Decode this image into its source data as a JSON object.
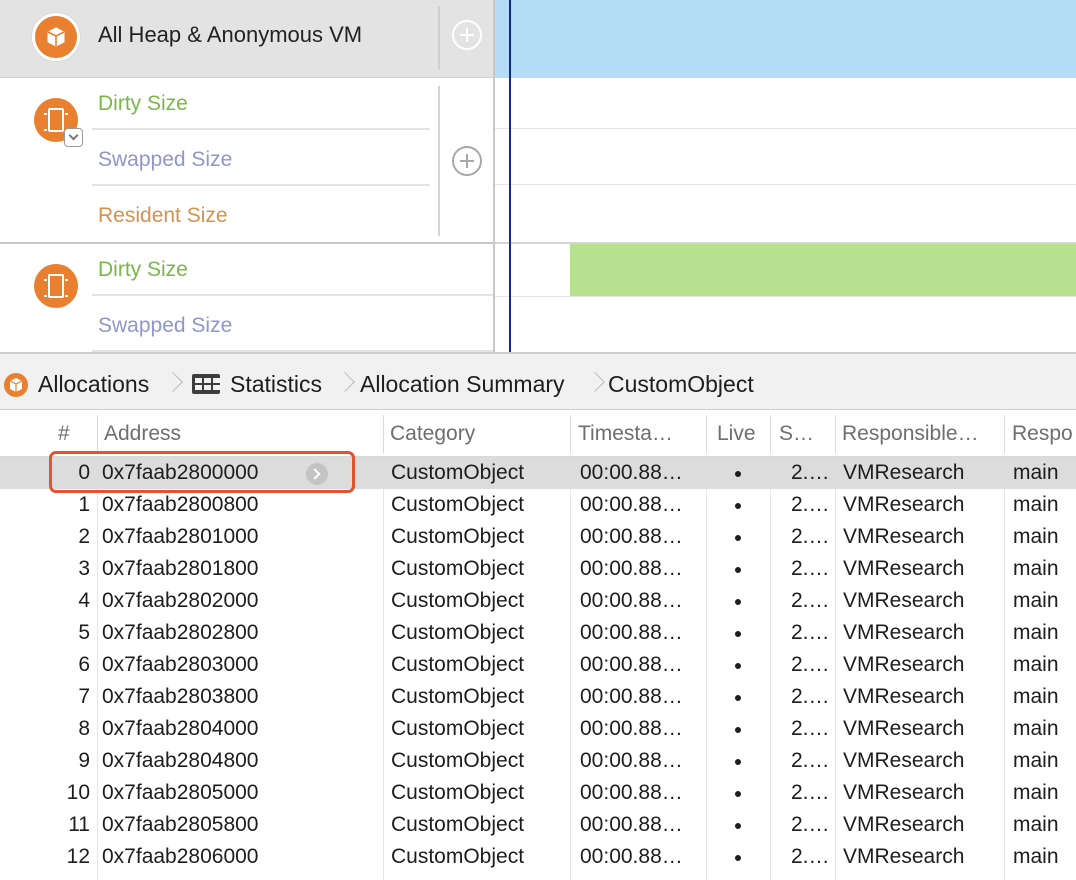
{
  "tracks": {
    "heap_title": "All Heap & Anonymous VM",
    "group1": {
      "dirty": "Dirty Size",
      "swapped": "Swapped Size",
      "resident": "Resident Size"
    },
    "group2": {
      "dirty": "Dirty Size",
      "swapped": "Swapped Size"
    },
    "colors": {
      "heap_fill": "#b4dcf7",
      "dirty_fill": "#b7e08f",
      "playhead": "#0e2a99",
      "accent": "#e9802f"
    }
  },
  "breadcrumb": {
    "items": [
      "Allocations",
      "Statistics",
      "Allocation Summary",
      "CustomObject"
    ],
    "icons": [
      "allocations-icon",
      "grid-icon"
    ]
  },
  "table": {
    "columns": [
      "#",
      "Address",
      "Category",
      "Timesta…",
      "Live",
      "S…",
      "Responsible…",
      "Respo"
    ],
    "selected_row": 0,
    "rows": [
      {
        "n": "0",
        "address": "0x7faab2800000",
        "category": "CustomObject",
        "timestamp": "00:00.88…",
        "live": "•",
        "size": "2.…",
        "library": "VMResearch",
        "caller": "main"
      },
      {
        "n": "1",
        "address": "0x7faab2800800",
        "category": "CustomObject",
        "timestamp": "00:00.88…",
        "live": "•",
        "size": "2.…",
        "library": "VMResearch",
        "caller": "main"
      },
      {
        "n": "2",
        "address": "0x7faab2801000",
        "category": "CustomObject",
        "timestamp": "00:00.88…",
        "live": "•",
        "size": "2.…",
        "library": "VMResearch",
        "caller": "main"
      },
      {
        "n": "3",
        "address": "0x7faab2801800",
        "category": "CustomObject",
        "timestamp": "00:00.88…",
        "live": "•",
        "size": "2.…",
        "library": "VMResearch",
        "caller": "main"
      },
      {
        "n": "4",
        "address": "0x7faab2802000",
        "category": "CustomObject",
        "timestamp": "00:00.88…",
        "live": "•",
        "size": "2.…",
        "library": "VMResearch",
        "caller": "main"
      },
      {
        "n": "5",
        "address": "0x7faab2802800",
        "category": "CustomObject",
        "timestamp": "00:00.88…",
        "live": "•",
        "size": "2.…",
        "library": "VMResearch",
        "caller": "main"
      },
      {
        "n": "6",
        "address": "0x7faab2803000",
        "category": "CustomObject",
        "timestamp": "00:00.88…",
        "live": "•",
        "size": "2.…",
        "library": "VMResearch",
        "caller": "main"
      },
      {
        "n": "7",
        "address": "0x7faab2803800",
        "category": "CustomObject",
        "timestamp": "00:00.88…",
        "live": "•",
        "size": "2.…",
        "library": "VMResearch",
        "caller": "main"
      },
      {
        "n": "8",
        "address": "0x7faab2804000",
        "category": "CustomObject",
        "timestamp": "00:00.88…",
        "live": "•",
        "size": "2.…",
        "library": "VMResearch",
        "caller": "main"
      },
      {
        "n": "9",
        "address": "0x7faab2804800",
        "category": "CustomObject",
        "timestamp": "00:00.88…",
        "live": "•",
        "size": "2.…",
        "library": "VMResearch",
        "caller": "main"
      },
      {
        "n": "10",
        "address": "0x7faab2805000",
        "category": "CustomObject",
        "timestamp": "00:00.88…",
        "live": "•",
        "size": "2.…",
        "library": "VMResearch",
        "caller": "main"
      },
      {
        "n": "11",
        "address": "0x7faab2805800",
        "category": "CustomObject",
        "timestamp": "00:00.88…",
        "live": "•",
        "size": "2.…",
        "library": "VMResearch",
        "caller": "main"
      },
      {
        "n": "12",
        "address": "0x7faab2806000",
        "category": "CustomObject",
        "timestamp": "00:00.88…",
        "live": "•",
        "size": "2.…",
        "library": "VMResearch",
        "caller": "main"
      }
    ]
  }
}
